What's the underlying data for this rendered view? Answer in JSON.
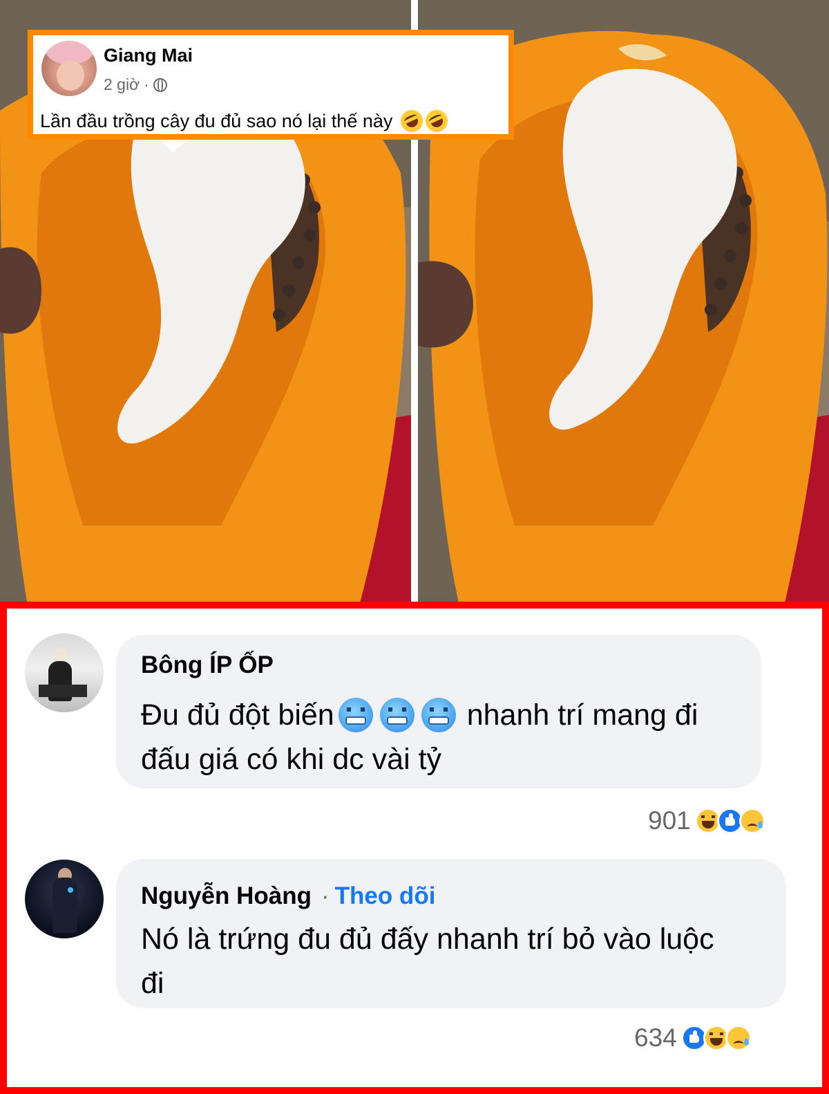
{
  "post": {
    "author": "Giang Mai",
    "time": "2 giờ",
    "separator": "·",
    "visibility_icon": "globe-icon",
    "text": "Lần đầu trồng cây đu đủ sao nó lại thế này",
    "emojis": [
      "rolling-on-floor-laughing",
      "rolling-on-floor-laughing"
    ]
  },
  "comments": [
    {
      "author": "Bông ÍP ỐP",
      "text_line1_before": "Đu đủ đột biến",
      "emojis": [
        "cold-face",
        "cold-face",
        "cold-face"
      ],
      "text_line1_after": "nhanh trí mang đi",
      "text_line2": "đấu giá có khi dc vài tỷ",
      "reaction_count": "901",
      "reactions": [
        "haha",
        "like",
        "sad"
      ]
    },
    {
      "author": "Nguyễn Hoàng",
      "separator": "·",
      "follow_label": "Theo dõi",
      "text_line1": "Nó là trứng đu đủ đấy nhanh trí bỏ vào luộc",
      "text_line2": "đi",
      "reaction_count": "634",
      "reactions": [
        "like",
        "haha",
        "sad"
      ]
    }
  ],
  "colors": {
    "post_highlight_border": "#ff8a00",
    "comments_highlight_border": "#ff0000",
    "link_blue": "#1877f2",
    "bubble_bg": "#f0f2f5",
    "meta_gray": "#65676b"
  }
}
